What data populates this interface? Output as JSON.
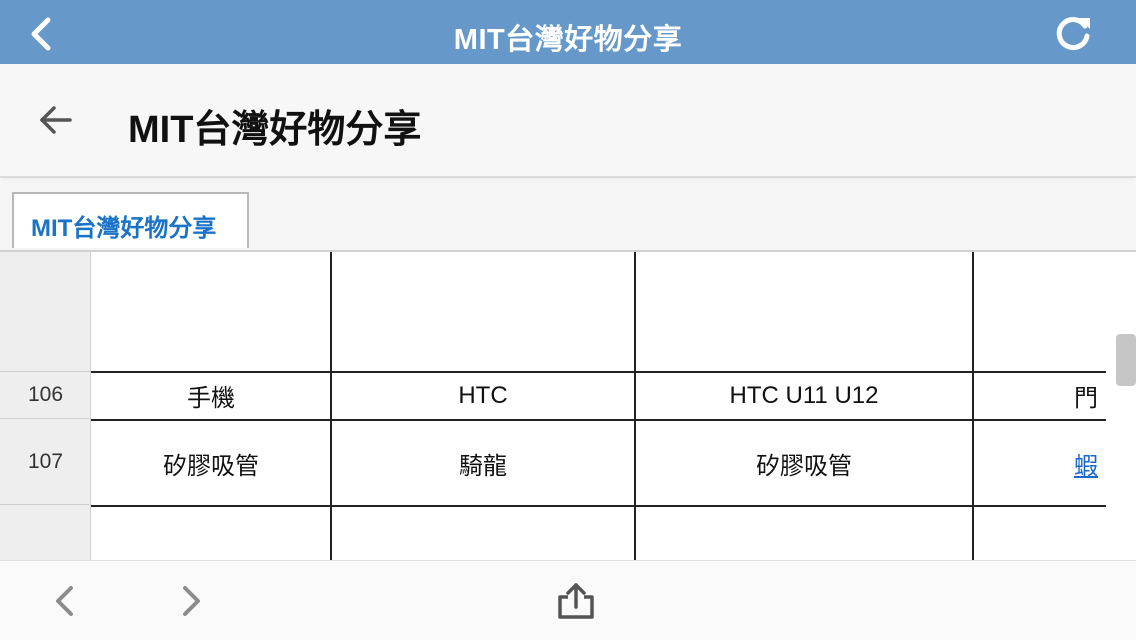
{
  "browser": {
    "title": "MIT台灣好物分享",
    "back_icon": "chevron-left-icon",
    "reload_icon": "reload-icon"
  },
  "header": {
    "back_icon": "arrow-left-icon",
    "title": "MIT台灣好物分享"
  },
  "sheet_tabs": [
    {
      "label": "MIT台灣好物分享",
      "active": true
    }
  ],
  "grid": {
    "rows": [
      {
        "number": "106",
        "cells": [
          "手機",
          "HTC",
          "HTC U11 U12",
          "門"
        ]
      },
      {
        "number": "107",
        "cells": [
          "矽膠吸管",
          "騎龍",
          "矽膠吸管",
          "蝦"
        ]
      }
    ],
    "link_color": "#1a66cc"
  },
  "toolbar": {
    "back_icon": "chevron-left-icon",
    "forward_icon": "chevron-right-icon",
    "share_icon": "share-icon"
  },
  "colors": {
    "browser_bar": "#6699c9",
    "tab_text": "#1a73c8"
  }
}
